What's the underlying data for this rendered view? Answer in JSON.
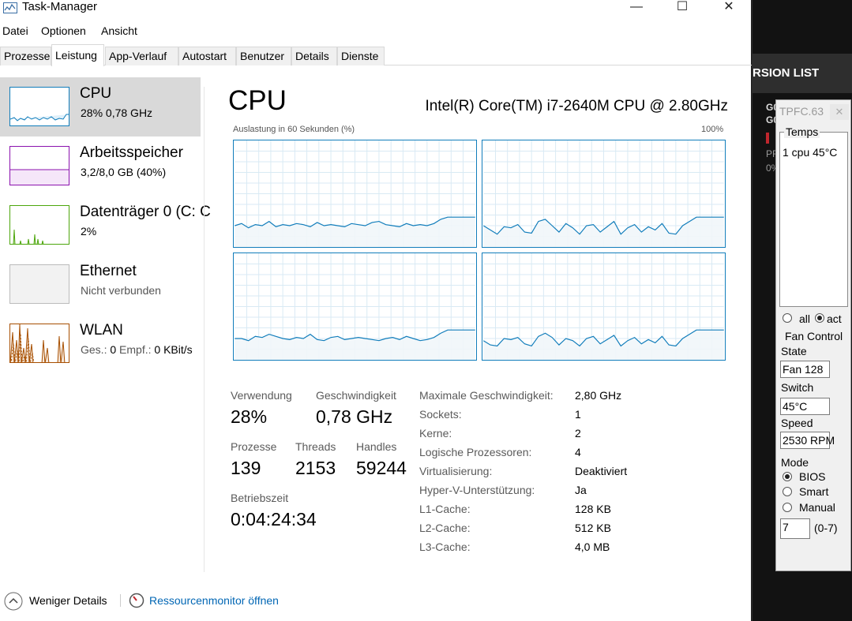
{
  "window": {
    "title": "Task-Manager"
  },
  "menu": [
    "Datei",
    "Optionen",
    "Ansicht"
  ],
  "tabs": [
    "Prozesse",
    "Leistung",
    "App-Verlauf",
    "Autostart",
    "Benutzer",
    "Details",
    "Dienste"
  ],
  "sidebar": [
    {
      "title": "CPU",
      "sub": "28%  0,78 GHz"
    },
    {
      "title": "Arbeitsspeicher",
      "sub": "3,2/8,0 GB (40%)"
    },
    {
      "title": "Datenträger 0 (C: C",
      "sub": "2%"
    },
    {
      "title": "Ethernet",
      "sub": "Nicht verbunden"
    },
    {
      "title": "WLAN",
      "sub_parts": [
        "Ges.:",
        "0",
        "Empf.:",
        "0 KBit/s"
      ]
    }
  ],
  "main": {
    "title": "CPU",
    "cpu_model": "Intel(R) Core(TM) i7-2640M CPU @ 2.80GHz",
    "graph_label": "Auslastung in 60 Sekunden (%)",
    "graph_max": "100%"
  },
  "stats": {
    "usage_label": "Verwendung",
    "usage": "28%",
    "speed_label": "Geschwindigkeit",
    "speed": "0,78 GHz",
    "processes_label": "Prozesse",
    "processes": "139",
    "threads_label": "Threads",
    "threads": "2153",
    "handles_label": "Handles",
    "handles": "59244",
    "uptime_label": "Betriebszeit",
    "uptime": "0:04:24:34"
  },
  "info": [
    {
      "k": "Maximale Geschwindigkeit:",
      "v": "2,80 GHz"
    },
    {
      "k": "Sockets:",
      "v": "1"
    },
    {
      "k": "Kerne:",
      "v": "2"
    },
    {
      "k": "Logische Prozessoren:",
      "v": "4"
    },
    {
      "k": "Virtualisierung:",
      "v": "Deaktiviert"
    },
    {
      "k": "Hyper-V-Unterstützung:",
      "v": "Ja"
    },
    {
      "k": "L1-Cache:",
      "v": "128 KB"
    },
    {
      "k": "L2-Cache:",
      "v": "512 KB"
    },
    {
      "k": "L3-Cache:",
      "v": "4,0 MB"
    }
  ],
  "footer": {
    "less": "Weniger Details",
    "resmon": "Ressourcenmonitor öffnen"
  },
  "bg_app": {
    "header": "RSION LIST",
    "letters": "G0",
    "sub1": "PF",
    "sub2": "0%"
  },
  "fan_control": {
    "title": "TPFC.63",
    "temps_label": "Temps",
    "temps_line": "1 cpu 45°C",
    "all": "all",
    "act": "act",
    "fan_control_label": "Fan Control",
    "state_label": "State",
    "state": "Fan 128",
    "switch_label": "Switch",
    "switch": "45°C",
    "speed_label": "Speed",
    "speed": "2530 RPM",
    "mode_label": "Mode",
    "modes": [
      "BIOS",
      "Smart",
      "Manual"
    ],
    "level": "7",
    "level_range": "(0-7)"
  },
  "colors": {
    "cpu": "#117dbb",
    "memory": "#8b12ae",
    "disk": "#4da60c",
    "wlan": "#a74f01",
    "selected": "#d9d9d9"
  },
  "cpu_history": [
    [
      20,
      22,
      18,
      21,
      20,
      24,
      19,
      21,
      20,
      22,
      21,
      19,
      23,
      20,
      21,
      20,
      19,
      22,
      21,
      20,
      23,
      24,
      21,
      20,
      19,
      22,
      20,
      21,
      20,
      22,
      26,
      28,
      28,
      28,
      28,
      28
    ],
    [
      20,
      16,
      12,
      19,
      18,
      21,
      14,
      13,
      24,
      26,
      20,
      14,
      22,
      18,
      12,
      20,
      21,
      14,
      19,
      24,
      12,
      18,
      21,
      14,
      19,
      16,
      22,
      13,
      12,
      20,
      24,
      28,
      28,
      28,
      28,
      28
    ],
    [
      20,
      20,
      18,
      22,
      21,
      24,
      22,
      20,
      19,
      21,
      20,
      24,
      19,
      18,
      21,
      22,
      19,
      20,
      21,
      20,
      19,
      18,
      20,
      21,
      19,
      22,
      20,
      18,
      19,
      21,
      25,
      28,
      28,
      28,
      28,
      28
    ],
    [
      18,
      14,
      13,
      20,
      19,
      21,
      15,
      13,
      22,
      25,
      21,
      14,
      20,
      18,
      13,
      20,
      22,
      15,
      19,
      23,
      13,
      18,
      21,
      15,
      19,
      16,
      22,
      14,
      13,
      20,
      24,
      28,
      28,
      28,
      28,
      28
    ]
  ]
}
